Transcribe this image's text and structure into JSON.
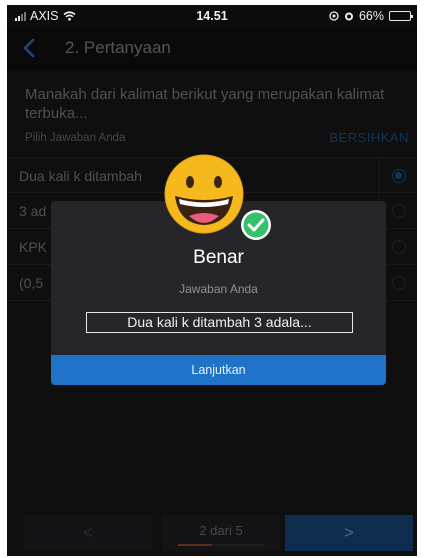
{
  "status_bar": {
    "carrier": "AXIS",
    "time": "14.51",
    "battery": "66%",
    "battery_level": 0.66
  },
  "header": {
    "title": "2. Pertanyaan"
  },
  "question": {
    "text": "Manakah dari kalimat berikut yang merupakan kalimat terbuka..."
  },
  "answer_section": {
    "prompt": "Pilih Jawaban Anda",
    "clear_label": "BERSIHKAN"
  },
  "options": [
    {
      "label": "Dua kali k ditambah",
      "selected": true
    },
    {
      "label": "3 ad",
      "selected": false
    },
    {
      "label": "KPK",
      "selected": false
    },
    {
      "label": "(0,5",
      "selected": false
    }
  ],
  "dialog": {
    "title": "Benar",
    "subtitle": "Jawaban Anda",
    "answer": "Dua kali k ditambah 3 adala...",
    "button_label": "Lanjutkan",
    "icon": "grinning-face-with-check-icon"
  },
  "bottom_nav": {
    "prev_label": "<",
    "page_indicator": "2 dari 5",
    "progress": 0.4,
    "next_label": ">"
  },
  "colors": {
    "accent": "#1e72c8",
    "progress": "#a0522d",
    "background": "#1b1b1d"
  }
}
